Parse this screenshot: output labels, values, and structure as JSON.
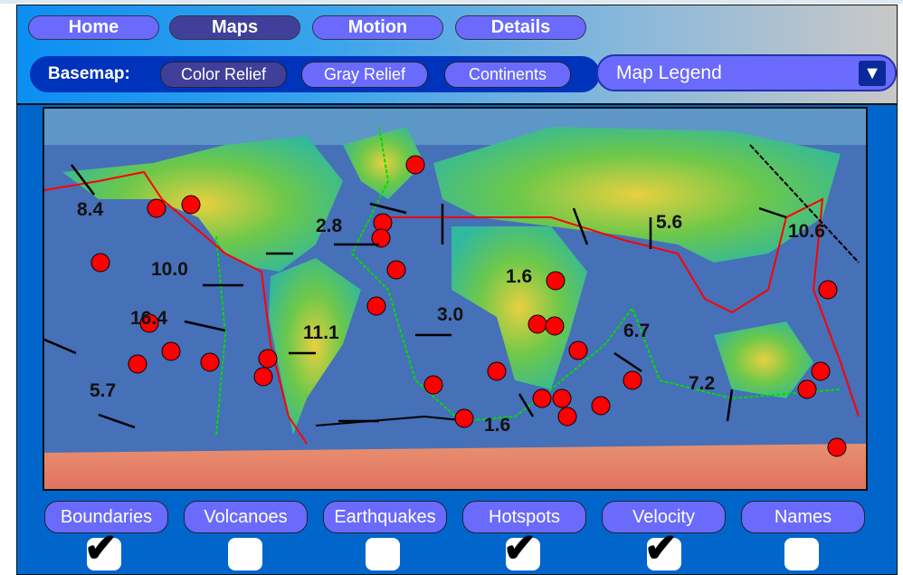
{
  "nav": {
    "tabs": [
      {
        "label": "Home",
        "active": false
      },
      {
        "label": "Maps",
        "active": true
      },
      {
        "label": "Motion",
        "active": false
      },
      {
        "label": "Details",
        "active": false
      }
    ]
  },
  "basemap": {
    "label": "Basemap:",
    "options": [
      {
        "label": "Color Relief",
        "active": true
      },
      {
        "label": "Gray Relief",
        "active": false
      },
      {
        "label": "Continents",
        "active": false
      }
    ]
  },
  "legend": {
    "label": "Map Legend",
    "icon": "triangle-down-icon"
  },
  "map": {
    "velocity_labels": [
      "8.4",
      "2.8",
      "5.6",
      "10.6",
      "10.0",
      "1.6",
      "16.4",
      "11.1",
      "3.0",
      "6.7",
      "5.7",
      "7.2",
      "1.6"
    ],
    "colors": {
      "hotspot": "#ff0000",
      "boundary_ridge": "#00dd00",
      "boundary_subduction": "#ff0000",
      "transform": "#000000"
    }
  },
  "layers": [
    {
      "label": "Boundaries",
      "checked": true
    },
    {
      "label": "Volcanoes",
      "checked": false
    },
    {
      "label": "Earthquakes",
      "checked": false
    },
    {
      "label": "Hotspots",
      "checked": true
    },
    {
      "label": "Velocity",
      "checked": true
    },
    {
      "label": "Names",
      "checked": false
    }
  ],
  "check_glyph": "✔"
}
